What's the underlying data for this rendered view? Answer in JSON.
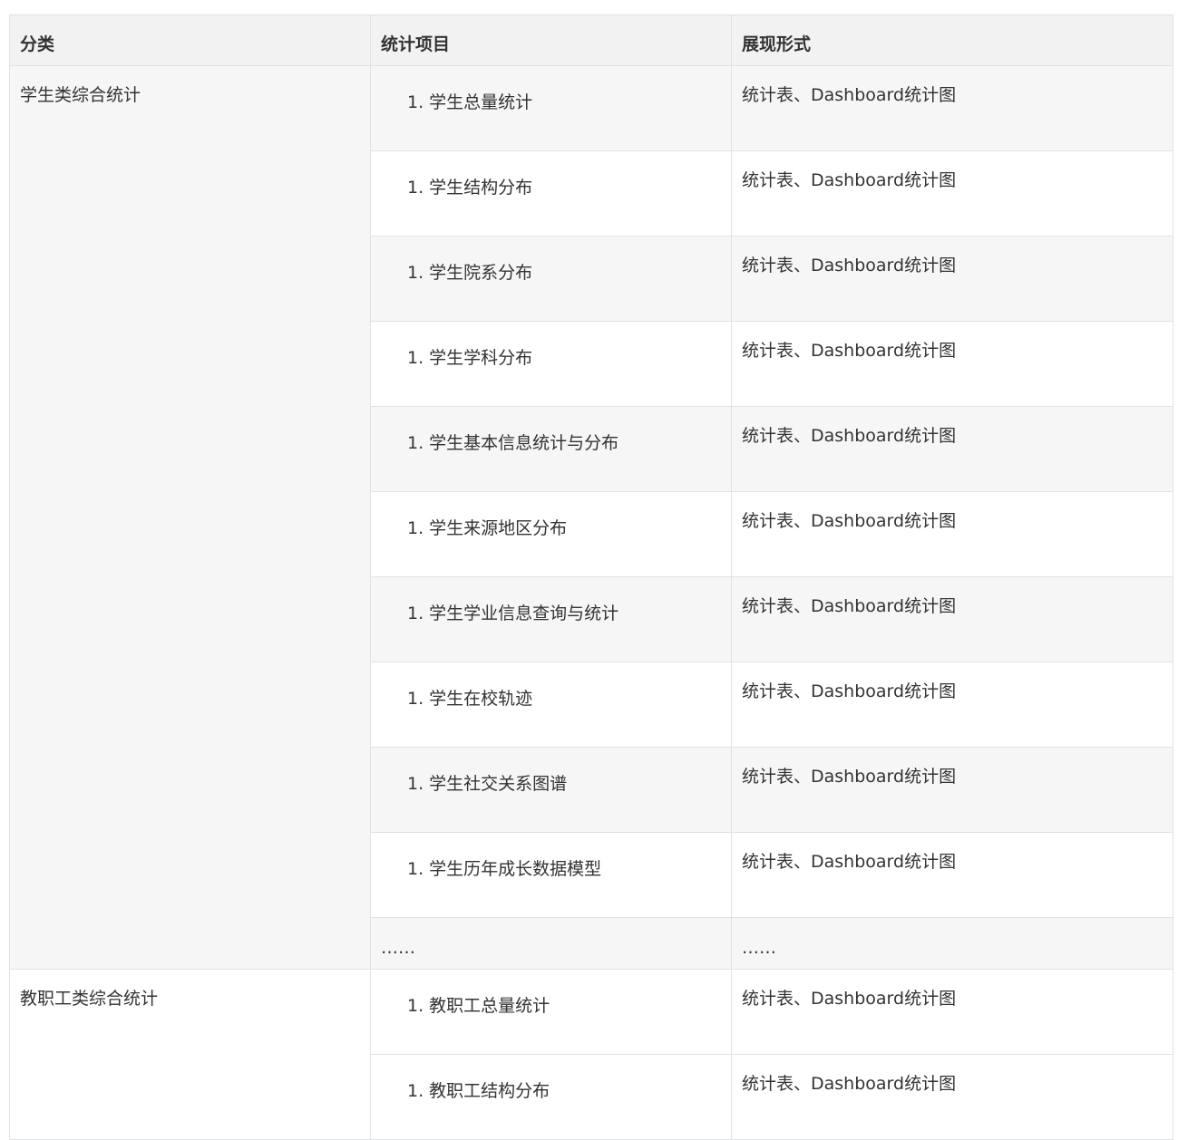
{
  "table": {
    "headers": [
      "分类",
      "统计项目",
      "展现形式"
    ],
    "groups": [
      {
        "category": "学生类综合统计",
        "items": [
          {
            "num": "1.",
            "label": "学生总量统计",
            "form": "统计表、Dashboard统计图"
          },
          {
            "num": "1.",
            "label": "学生结构分布",
            "form": "统计表、Dashboard统计图"
          },
          {
            "num": "1.",
            "label": "学生院系分布",
            "form": "统计表、Dashboard统计图"
          },
          {
            "num": "1.",
            "label": "学生学科分布",
            "form": "统计表、Dashboard统计图"
          },
          {
            "num": "1.",
            "label": "学生基本信息统计与分布",
            "form": "统计表、Dashboard统计图"
          },
          {
            "num": "1.",
            "label": "学生来源地区分布",
            "form": "统计表、Dashboard统计图"
          },
          {
            "num": "1.",
            "label": "学生学业信息查询与统计",
            "form": "统计表、Dashboard统计图"
          },
          {
            "num": "1.",
            "label": "学生在校轨迹",
            "form": "统计表、Dashboard统计图"
          },
          {
            "num": "1.",
            "label": "学生社交关系图谱",
            "form": "统计表、Dashboard统计图"
          },
          {
            "num": "1.",
            "label": "学生历年成长数据模型",
            "form": "统计表、Dashboard统计图"
          }
        ],
        "ellipsis": {
          "item": "……",
          "form": "……"
        }
      },
      {
        "category": "教职工类综合统计",
        "items": [
          {
            "num": "1.",
            "label": "教职工总量统计",
            "form": "统计表、Dashboard统计图"
          },
          {
            "num": "1.",
            "label": "教职工结构分布",
            "form": "统计表、Dashboard统计图"
          }
        ]
      }
    ]
  }
}
